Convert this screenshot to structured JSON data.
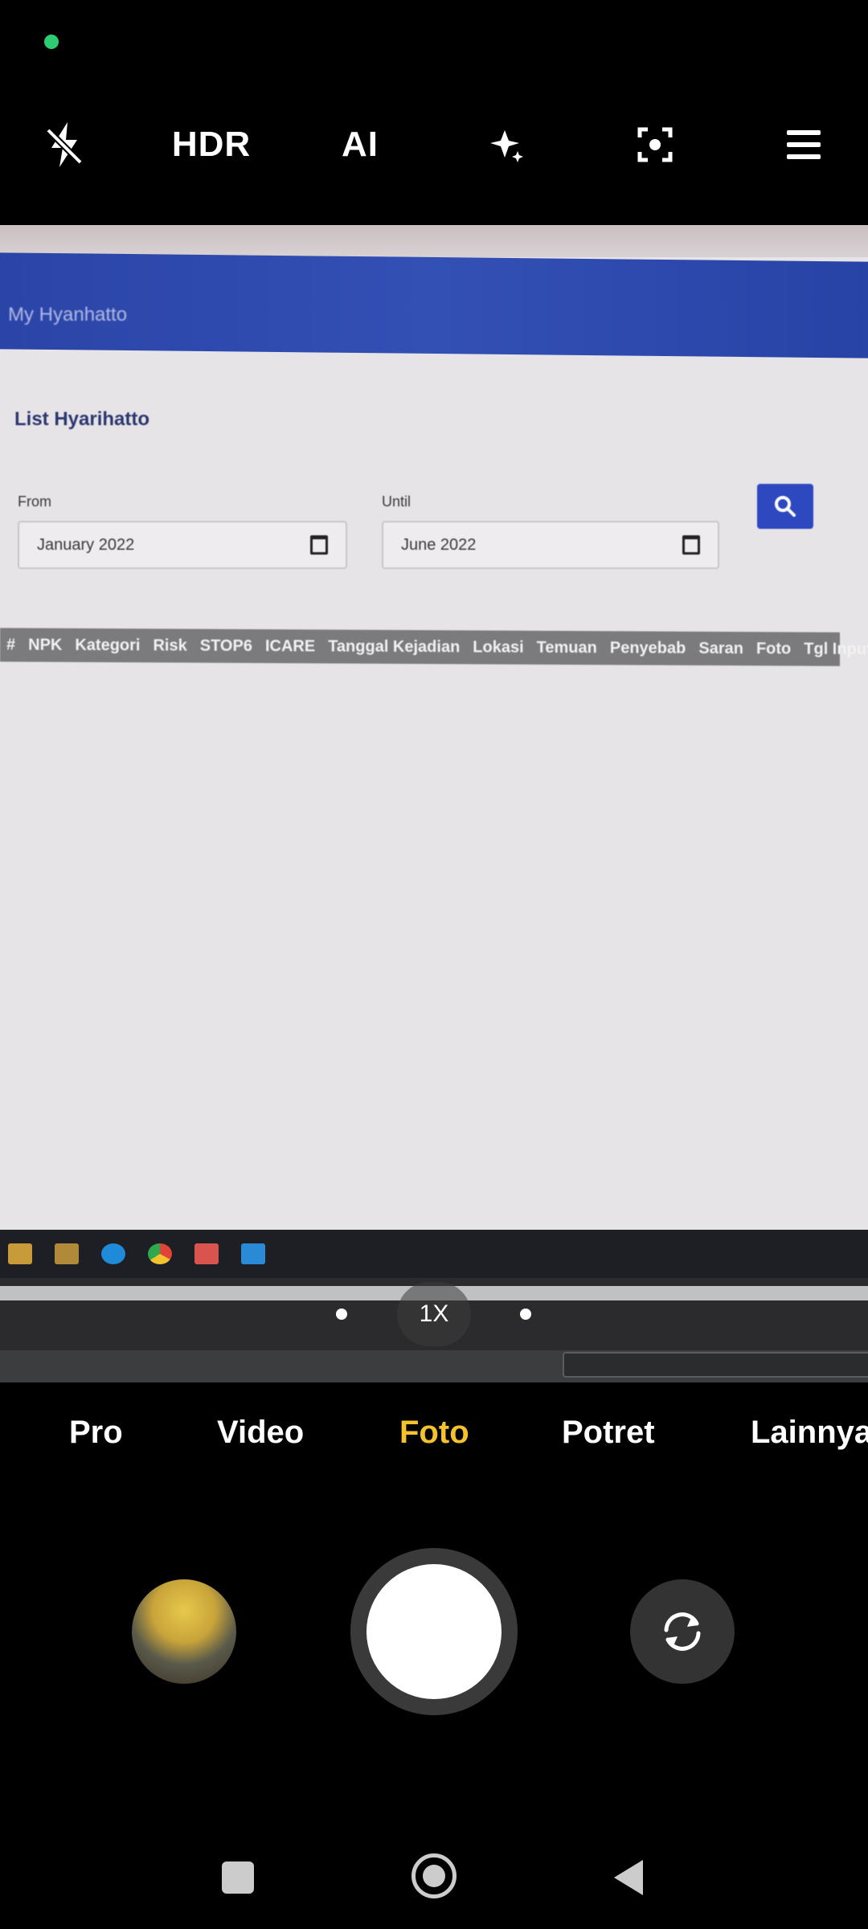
{
  "status": {
    "indicator_color": "#2ecc71"
  },
  "toolbar": {
    "items": [
      {
        "icon": "flash-off-icon"
      },
      {
        "label": "HDR",
        "icon": "hdr-off-icon"
      },
      {
        "label": "AI",
        "icon": "ai-icon"
      },
      {
        "icon": "beauty-sparkle-icon"
      },
      {
        "icon": "focus-scan-icon"
      },
      {
        "icon": "menu-icon"
      }
    ]
  },
  "viewfinder": {
    "app_header": "My Hyanhatto",
    "page_title": "List Hyarihatto",
    "from_label": "From",
    "from_value": "January 2022",
    "until_label": "Until",
    "until_value": "June 2022",
    "table_columns": [
      "#",
      "NPK",
      "Kategori",
      "Risk",
      "STOP6",
      "ICARE",
      "Tanggal Kejadian",
      "Lokasi",
      "Temuan",
      "Penyebab",
      "Saran",
      "Foto",
      "Tgl Input"
    ]
  },
  "zoom": {
    "label": "1X"
  },
  "modes": {
    "items": [
      "Pro",
      "Video",
      "Foto",
      "Potret",
      "Lainnya"
    ],
    "active": "Foto",
    "active_color": "#f4c22d"
  },
  "nav": {
    "icons": [
      "recents-icon",
      "home-icon",
      "back-icon"
    ]
  }
}
